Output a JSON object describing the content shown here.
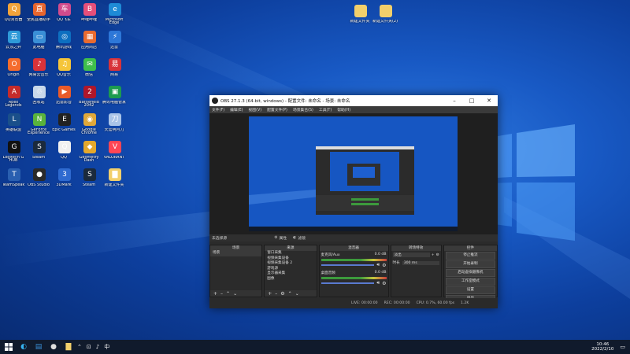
{
  "desktop": {
    "icons": [
      {
        "label": "QQ浏览器",
        "color": "#f2a33a",
        "glyph": "Q"
      },
      {
        "label": "全民直播助手",
        "color": "#e8662e",
        "glyph": "直"
      },
      {
        "label": "QQ飞车",
        "color": "#d24b8c",
        "glyph": "车"
      },
      {
        "label": "哔哩哔哩",
        "color": "#e64f7a",
        "glyph": "B"
      },
      {
        "label": "Microsoft Edge",
        "color": "#1e8bd6",
        "glyph": "e"
      },
      {
        "label": "云顶之弈",
        "color": "#2e9ad8",
        "glyph": "云"
      },
      {
        "label": "此电脑",
        "color": "#3a8fd6",
        "glyph": "▭"
      },
      {
        "label": "腾讯游戏",
        "color": "#0d6fc0",
        "glyph": "◎"
      },
      {
        "label": "应用商店",
        "color": "#e86b2f",
        "glyph": "▦"
      },
      {
        "label": "迅雷",
        "color": "#2d77d8",
        "glyph": "⚡"
      },
      {
        "label": "Origin",
        "color": "#f56c2d",
        "glyph": "O"
      },
      {
        "label": "网易云音乐",
        "color": "#d8333a",
        "glyph": "♪"
      },
      {
        "label": "QQ音乐",
        "color": "#f5c53a",
        "glyph": "♫"
      },
      {
        "label": "微信",
        "color": "#3fbf4c",
        "glyph": "✉"
      },
      {
        "label": "网易",
        "color": "#d8333a",
        "glyph": "易"
      },
      {
        "label": "Apex Legends",
        "color": "#c52b2b",
        "glyph": "A"
      },
      {
        "label": "回收站",
        "color": "#c8d8ea",
        "glyph": "♲"
      },
      {
        "label": "迅雷影音",
        "color": "#e85a2a",
        "glyph": "▶"
      },
      {
        "label": "Battlefield 2042",
        "color": "#b0162a",
        "glyph": "2"
      },
      {
        "label": "腾讯电脑管家",
        "color": "#1c9b4f",
        "glyph": "▣"
      },
      {
        "label": "英雄联盟",
        "color": "#1a4f8a",
        "glyph": "L"
      },
      {
        "label": "GeForce Experience",
        "color": "#59b33c",
        "glyph": "N"
      },
      {
        "label": "Epic Games",
        "color": "#222222",
        "glyph": "E"
      },
      {
        "label": "Google Chrome",
        "color": "#e0a83a",
        "glyph": "◉"
      },
      {
        "label": "天涯明月刀",
        "color": "#a9c4e8",
        "glyph": "刀"
      },
      {
        "label": "Logitech G HUB",
        "color": "#111111",
        "glyph": "G"
      },
      {
        "label": "Steam",
        "color": "#1b2a3c",
        "glyph": "S"
      },
      {
        "label": "QQ",
        "color": "#f0f0f0",
        "glyph": "Q"
      },
      {
        "label": "Geometry Dash",
        "color": "#e4a82c",
        "glyph": "◆"
      },
      {
        "label": "VALORANT",
        "color": "#ff4655",
        "glyph": "V"
      },
      {
        "label": "TeamSpeak",
        "color": "#2a5fb0",
        "glyph": "T"
      },
      {
        "label": "OBS Studio",
        "color": "#2a2a2a",
        "glyph": "●"
      },
      {
        "label": "3DMark",
        "color": "#2e6ad0",
        "glyph": "3"
      },
      {
        "label": "Steam",
        "color": "#1b2a3c",
        "glyph": "S"
      },
      {
        "label": "新建文件夹",
        "color": "#f2cf6b",
        "glyph": "▇"
      }
    ],
    "folders": [
      {
        "label": "新建文件夹",
        "color": "#f2cf6b"
      },
      {
        "label": "新建文件夹(2)",
        "color": "#f2cf6b"
      }
    ]
  },
  "obs": {
    "title": "OBS 27.1.3 (64-bit, windows) - 配置文件: 未命名 - 场景: 未命名",
    "menu": [
      "文件(F)",
      "编辑(E)",
      "视图(V)",
      "配置文件(P)",
      "场景集合(S)",
      "工具(T)",
      "帮助(H)"
    ],
    "subbar": {
      "left": "未选择源",
      "props": "属性",
      "filters": "滤镜"
    },
    "panels": {
      "scenes": {
        "title": "场景",
        "item": "场景"
      },
      "sources": {
        "title": "来源",
        "items": [
          "窗口采集",
          "视频采集设备",
          "视频采集设备 2",
          "游戏源",
          "显示器采集",
          "图像"
        ]
      },
      "mixer": {
        "title": "混音器",
        "ch1": "麦克风/Aux",
        "ch2": "桌面音频",
        "db1": "0.0 dB",
        "db2": "0.0 dB"
      },
      "transitions": {
        "title": "转场特效",
        "fade": "淡出",
        "duration_label": "时长",
        "duration": "300 ms"
      },
      "controls": {
        "title": "控件",
        "buttons": [
          "停止推流",
          "开始录制",
          "启动虚拟摄像机",
          "工作室模式",
          "设置",
          "退出"
        ]
      }
    },
    "status": {
      "live": "LIVE: 00:00:00",
      "rec": "REC: 00:00:00",
      "cpu": "CPU: 0.7%, 60.00 fps",
      "bitrate": "1.2K"
    }
  },
  "taskbar": {
    "time": "10:46",
    "date": "2022/2/10"
  },
  "colors": {
    "accent": "#1656c2",
    "taskbar": "#101a2c",
    "obsbg": "#2b2b2b"
  }
}
